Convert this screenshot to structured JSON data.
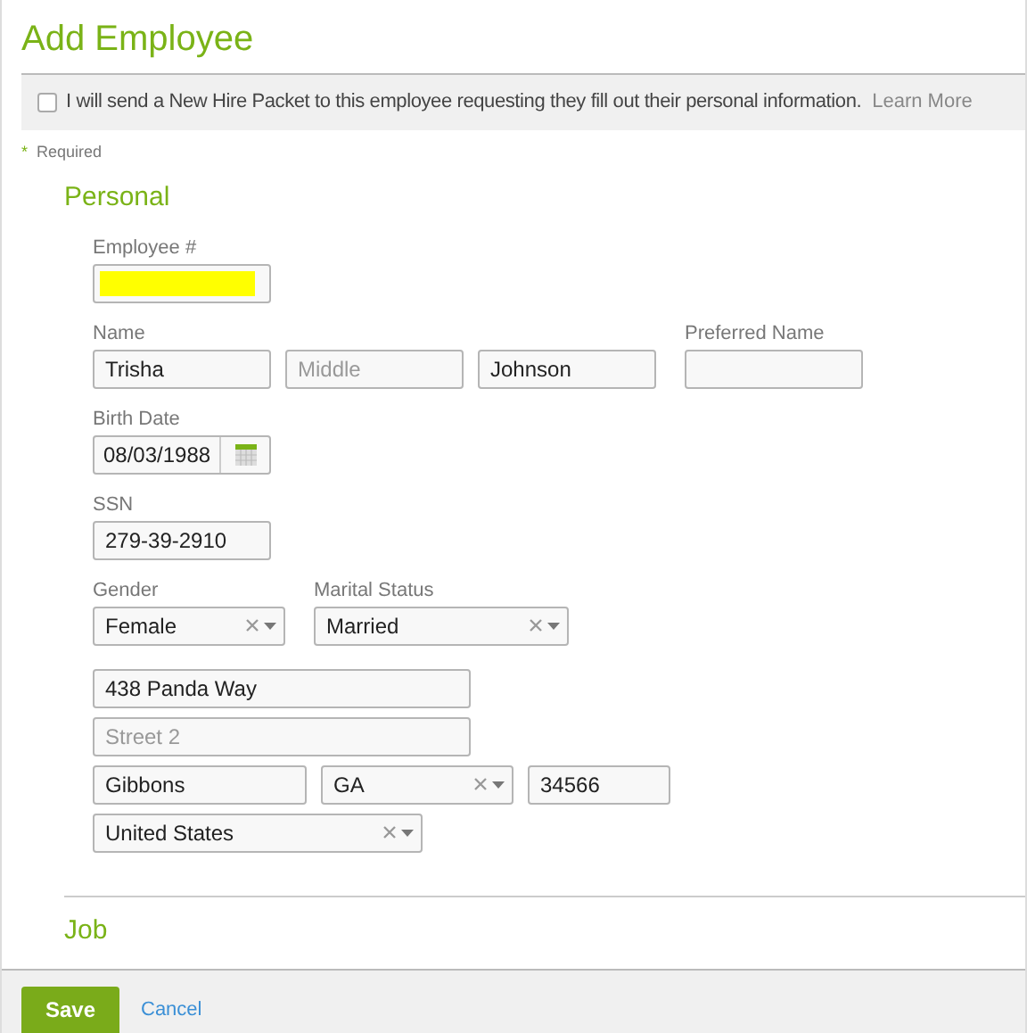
{
  "title": "Add Employee",
  "packet": {
    "checked": false,
    "text": "I will send a New Hire Packet to this employee requesting they fill out their personal information.",
    "link": "Learn More"
  },
  "required_note": {
    "mark": "*",
    "text": "Required"
  },
  "personal": {
    "heading": "Personal",
    "employee_number": {
      "label": "Employee #",
      "redacted": true
    },
    "name": {
      "label": "Name",
      "fields": [
        {
          "value": "Trisha"
        },
        {
          "placeholder": "Middle"
        },
        {
          "value": "Johnson"
        }
      ]
    },
    "preferred_name": {
      "label": "Preferred Name"
    },
    "birth_date": {
      "label": "Birth Date",
      "value": "08/03/1988"
    },
    "ssn": {
      "label": "SSN",
      "value": "279-39-2910"
    },
    "gender": {
      "label": "Gender",
      "value": "Female"
    },
    "marital_status": {
      "label": "Marital Status",
      "value": "Married"
    },
    "address": {
      "street1": {
        "value": "438 Panda Way"
      },
      "street2": {
        "placeholder": "Street 2"
      },
      "city": {
        "value": "Gibbons"
      },
      "state": {
        "value": "GA"
      },
      "zip": {
        "value": "34566"
      },
      "country": {
        "value": "United States"
      }
    }
  },
  "job": {
    "heading": "Job"
  },
  "footer": {
    "save": "Save",
    "cancel": "Cancel"
  }
}
